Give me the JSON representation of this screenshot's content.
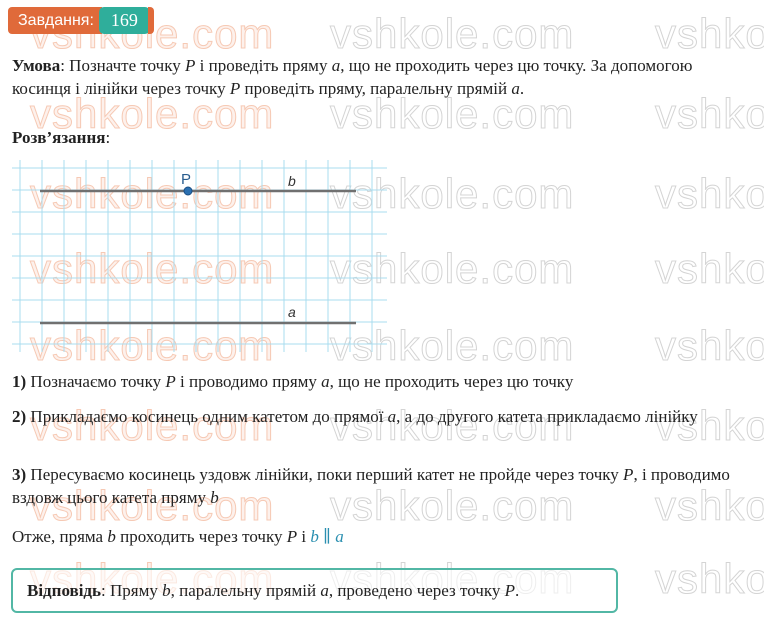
{
  "badge": {
    "label": "Завдання:",
    "number": "169"
  },
  "watermark": "vshkole.com",
  "condition": {
    "label": "Умова",
    "text1": ": Позначте точку ",
    "p1": "P",
    "text2": " і проведіть пряму ",
    "a1": "a",
    "text3": ", що не проходить через цю точку. За допомогою косинця і лінійки через точку ",
    "p2": "P",
    "text4": " проведіть пряму, паралельну прямій ",
    "a2": "a",
    "text5": "."
  },
  "solution_label": "Розв’язання",
  "solution_colon": ":",
  "figure": {
    "point_label": "P",
    "line_b_label": "b",
    "line_a_label": "a"
  },
  "steps": [
    {
      "num": "1)",
      "parts": [
        " Позначаємо точку ",
        "P",
        " і проводимо пряму ",
        "a",
        ", що не проходить через цю точку"
      ]
    },
    {
      "num": "2)",
      "parts": [
        " Прикладаємо косинець одним катетом до прямої ",
        "a",
        ", а до другого катета прикладаємо лінійку"
      ]
    },
    {
      "num": "3)",
      "parts": [
        " Пересуваємо косинець уздовж лінійки, поки перший катет не пройде через точку ",
        "P",
        ", і проводимо вздовж цього катета пряму ",
        "b"
      ]
    }
  ],
  "conclusion": {
    "t1": "Отже, пряма ",
    "b": "b",
    "t2": " проходить через точку ",
    "p": "P",
    "t3": " і ",
    "rel": "b ∥ a"
  },
  "answer": {
    "label": "Відповідь",
    "t1": ": Пряму ",
    "b": "b",
    "t2": ", паралельну прямій ",
    "a": "a",
    "t3": ", проведено через точку ",
    "p": "P",
    "t4": "."
  },
  "colors": {
    "badge_orange": "#e06a3a",
    "badge_teal": "#2fae9b",
    "grid_line": "#a9dcef",
    "line": "#707070",
    "point": "#2a6fb0",
    "accent": "#2a8fb0"
  }
}
